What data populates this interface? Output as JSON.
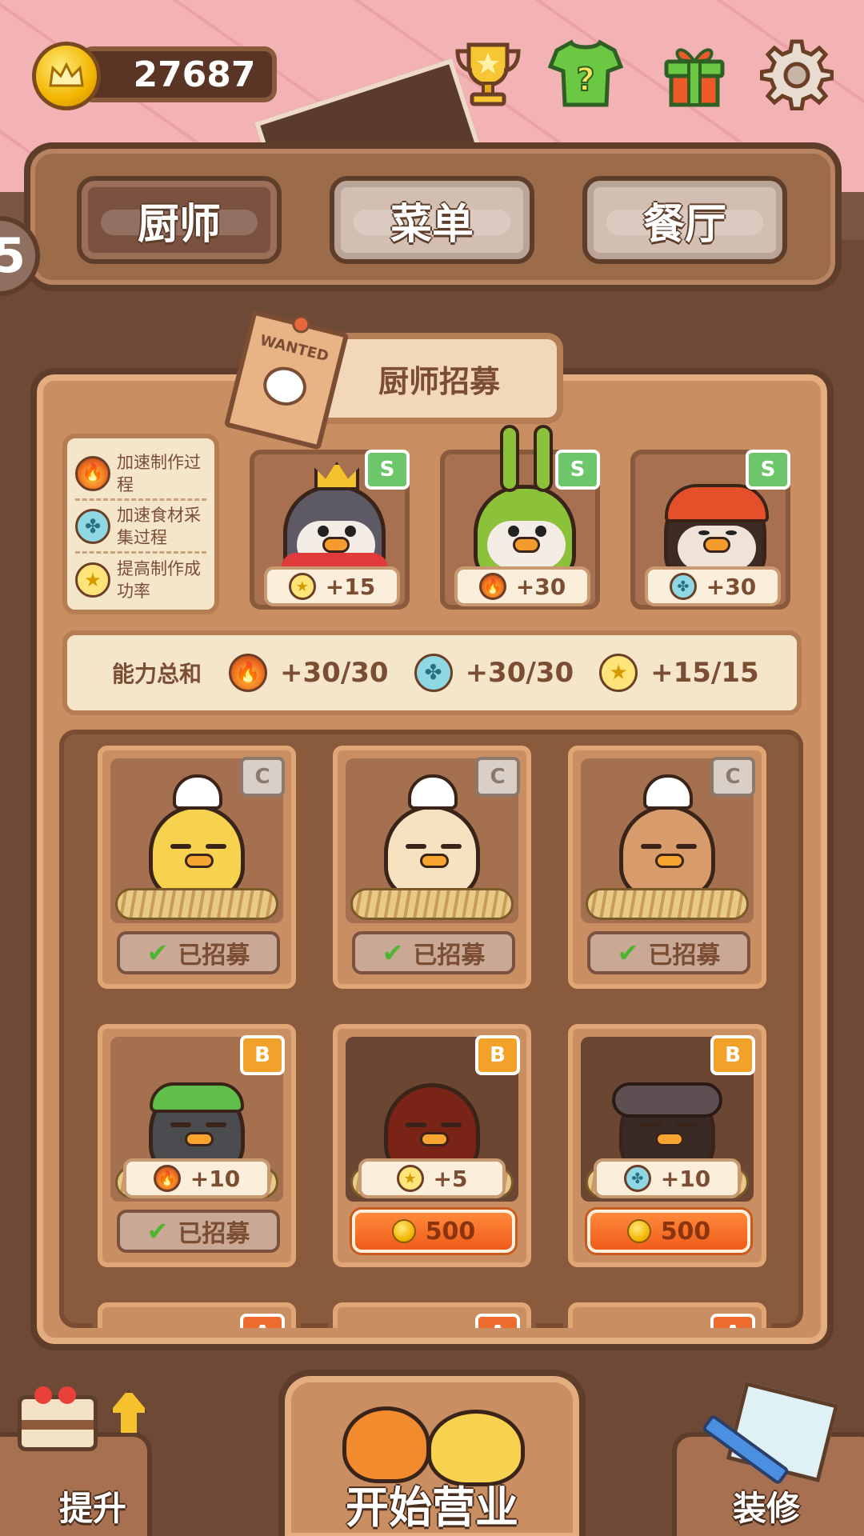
{
  "currency": {
    "coins": "27687",
    "icon": "crown-coin-icon"
  },
  "top_icons": [
    {
      "name": "trophy-icon"
    },
    {
      "name": "outfit-mystery-icon",
      "glyph": "?"
    },
    {
      "name": "gift-icon"
    },
    {
      "name": "gear-icon"
    }
  ],
  "side_badge": "5",
  "tabs": [
    {
      "label": "厨师",
      "active": true
    },
    {
      "label": "菜单",
      "active": false
    },
    {
      "label": "餐厅",
      "active": false
    }
  ],
  "recruit": {
    "title": "厨师招募",
    "poster_text": "WANTED"
  },
  "legend": [
    {
      "icon": "fire-icon",
      "text": "加速制作过程"
    },
    {
      "icon": "fan-icon",
      "text": "加速食材采集过程"
    },
    {
      "icon": "star-icon",
      "text": "提高制作成功率"
    }
  ],
  "featured_chefs": [
    {
      "grade": "S",
      "stat_icon": "star-icon",
      "stat": "+15",
      "color": "#5d5a66"
    },
    {
      "grade": "S",
      "stat_icon": "fire-icon",
      "stat": "+30",
      "color": "#8cc13a"
    },
    {
      "grade": "S",
      "stat_icon": "fan-icon",
      "stat": "+30",
      "color": "#3d2a22"
    }
  ],
  "ability_total": {
    "label": "能力总和",
    "fire": "+30/30",
    "fan": "+30/30",
    "star": "+15/15"
  },
  "chefs": [
    {
      "grade": "C",
      "status": "recruited",
      "status_label": "已招募",
      "color": "#f6d24f"
    },
    {
      "grade": "C",
      "status": "recruited",
      "status_label": "已招募",
      "color": "#f5e2c0"
    },
    {
      "grade": "C",
      "status": "recruited",
      "status_label": "已招募",
      "color": "#d79b6c"
    },
    {
      "grade": "B",
      "status": "recruited",
      "status_label": "已招募",
      "stat_icon": "fire-icon",
      "stat": "+10",
      "color": "#4a4c4f"
    },
    {
      "grade": "B",
      "status": "price",
      "price": "500",
      "stat_icon": "star-icon",
      "stat": "+5",
      "color": "#7a2317"
    },
    {
      "grade": "B",
      "status": "price",
      "price": "500",
      "stat_icon": "fan-icon",
      "stat": "+10",
      "color": "#3a2a26"
    }
  ],
  "next_row_grades": [
    "A",
    "A",
    "A"
  ],
  "bottom": {
    "upgrade_label": "提升",
    "start_label": "开始营业",
    "decorate_label": "装修"
  }
}
